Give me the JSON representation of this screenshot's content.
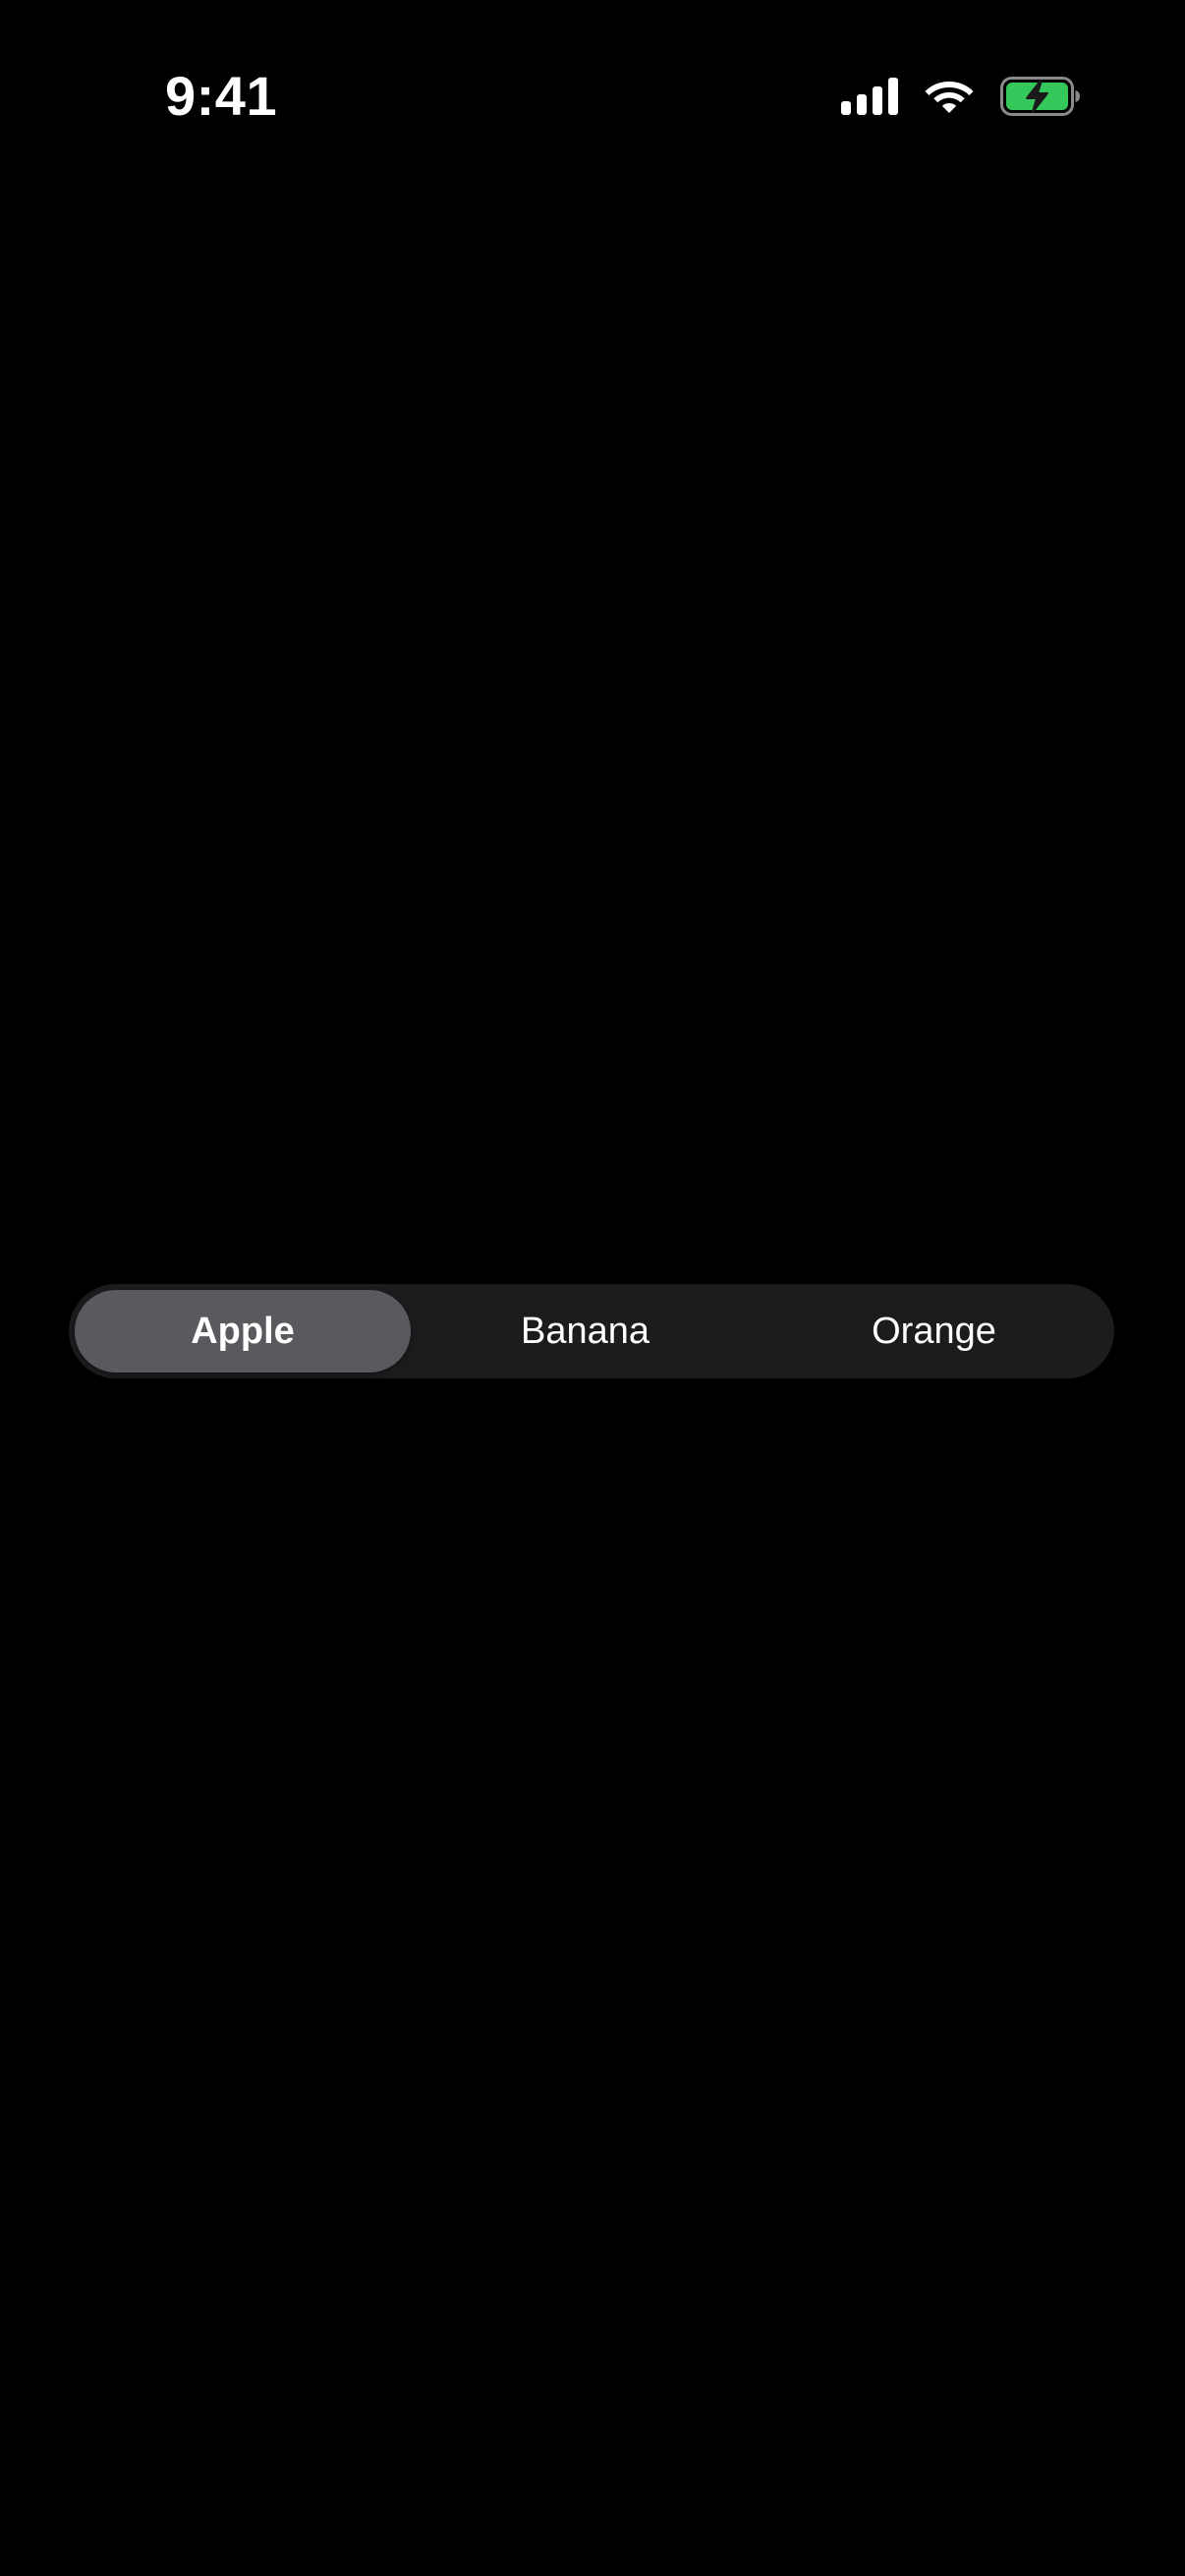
{
  "status_bar": {
    "time": "9:41",
    "icons": [
      "cellular-signal-icon",
      "wifi-icon",
      "battery-charging-icon"
    ],
    "battery_color": "#34c759",
    "battery_charging": true
  },
  "segmented_control": {
    "segments": [
      {
        "label": "Apple",
        "selected": true
      },
      {
        "label": "Banana",
        "selected": false
      },
      {
        "label": "Orange",
        "selected": false
      }
    ],
    "selected_index": 0,
    "track_color": "#1c1c1e",
    "selected_color": "#5a5a5e"
  }
}
